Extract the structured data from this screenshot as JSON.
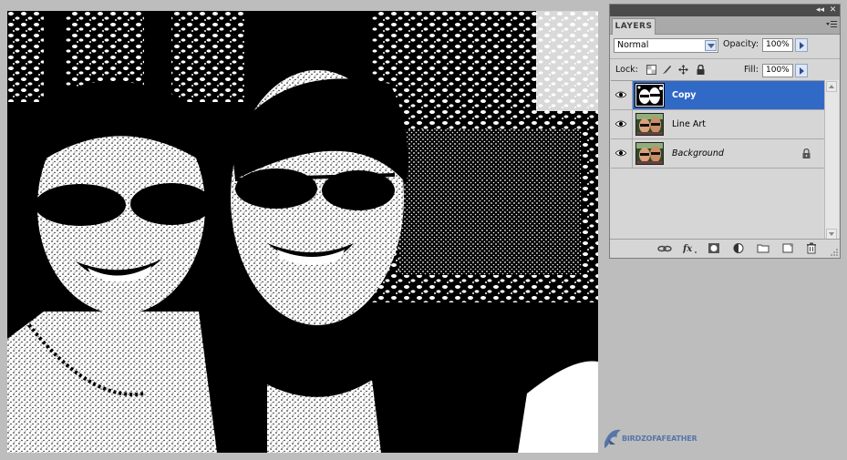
{
  "panel": {
    "tab_label": "LAYERS",
    "blend_mode": "Normal",
    "opacity_label": "Opacity:",
    "opacity_value": "100%",
    "lock_label": "Lock:",
    "fill_label": "Fill:",
    "fill_value": "100%"
  },
  "layers": [
    {
      "name": "Copy",
      "selected": true,
      "visible": true,
      "locked": false,
      "italic": false
    },
    {
      "name": "Line Art",
      "selected": false,
      "visible": true,
      "locked": false,
      "italic": false
    },
    {
      "name": "Background",
      "selected": false,
      "visible": true,
      "locked": true,
      "italic": true
    }
  ],
  "footer_icons": [
    "link-icon",
    "fx-icon",
    "mask-icon",
    "adjustment-icon",
    "folder-icon",
    "new-layer-icon",
    "trash-icon"
  ],
  "watermark": {
    "text": "Birdzofafeather"
  },
  "colors": {
    "selection": "#3169c6",
    "panel_bg": "#d6d6d6",
    "workspace_bg": "#bdbdbd"
  }
}
